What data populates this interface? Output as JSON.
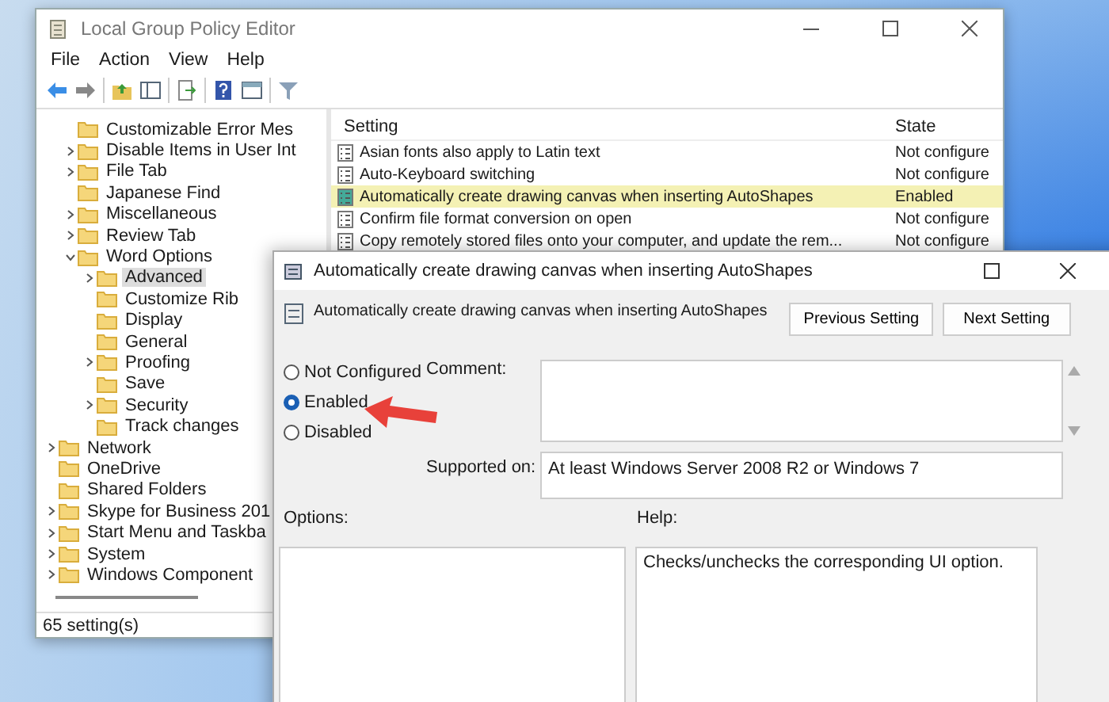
{
  "main_window": {
    "title": "Local Group Policy Editor",
    "menu": [
      "File",
      "Action",
      "View",
      "Help"
    ],
    "tree": {
      "items": [
        {
          "label": "Customizable Error Mes",
          "selected": false
        },
        {
          "label": "Disable Items in User Int",
          "expanded": false,
          "selected": false
        },
        {
          "label": "File Tab",
          "expanded": false,
          "selected": false
        },
        {
          "label": "Japanese Find",
          "selected": false
        },
        {
          "label": "Miscellaneous",
          "expanded": false,
          "selected": false
        },
        {
          "label": "Review Tab",
          "expanded": false,
          "selected": false
        },
        {
          "label": "Word Options",
          "expanded": true,
          "selected": false,
          "children": [
            {
              "label": "Advanced",
              "expanded": false,
              "selected": true
            },
            {
              "label": "Customize Rib",
              "selected": false
            },
            {
              "label": "Display",
              "selected": false
            },
            {
              "label": "General",
              "selected": false
            },
            {
              "label": "Proofing",
              "expanded": false,
              "selected": false
            },
            {
              "label": "Save",
              "selected": false
            },
            {
              "label": "Security",
              "expanded": false,
              "selected": false
            },
            {
              "label": "Track changes",
              "selected": false
            }
          ]
        }
      ],
      "outer_items": [
        {
          "label": "Network",
          "expanded": false,
          "selected": false
        },
        {
          "label": "OneDrive",
          "selected": false
        },
        {
          "label": "Shared Folders",
          "selected": false
        },
        {
          "label": "Skype for Business 201",
          "expanded": false,
          "selected": false
        },
        {
          "label": "Start Menu and Taskba",
          "expanded": false,
          "selected": false
        },
        {
          "label": "System",
          "expanded": false,
          "selected": false
        },
        {
          "label": "Windows Component",
          "expanded": false,
          "selected": false
        }
      ]
    },
    "table": {
      "columns": [
        "Setting",
        "State"
      ],
      "rows": [
        {
          "setting": "Asian fonts also apply to Latin text",
          "state": "Not configure",
          "selected": false
        },
        {
          "setting": "Auto-Keyboard switching",
          "state": "Not configure",
          "selected": false
        },
        {
          "setting": "Automatically create drawing canvas when inserting AutoShapes",
          "state": "Enabled",
          "selected": true
        },
        {
          "setting": "Confirm file format conversion on open",
          "state": "Not configure",
          "selected": false
        },
        {
          "setting": "Copy remotely stored files onto your computer, and update the rem...",
          "state": "Not configure",
          "selected": false
        }
      ]
    },
    "status_bar": "65 setting(s)"
  },
  "dialog": {
    "title": "Automatically create drawing canvas when inserting AutoShapes",
    "heading": "Automatically create drawing canvas when inserting AutoShapes",
    "buttons": [
      "Previous Setting",
      "Next Setting"
    ],
    "options": [
      {
        "label": "Not Configured",
        "selected": false
      },
      {
        "label": "Enabled",
        "selected": true
      },
      {
        "label": "Disabled",
        "selected": false
      }
    ],
    "comment_label": "Comment:",
    "supported_label": "Supported on:",
    "supported_value": "At least Windows Server 2008 R2 or Windows 7",
    "options_label": "Options:",
    "help_label": "Help:",
    "help_text": "Checks/unchecks the corresponding UI option."
  }
}
